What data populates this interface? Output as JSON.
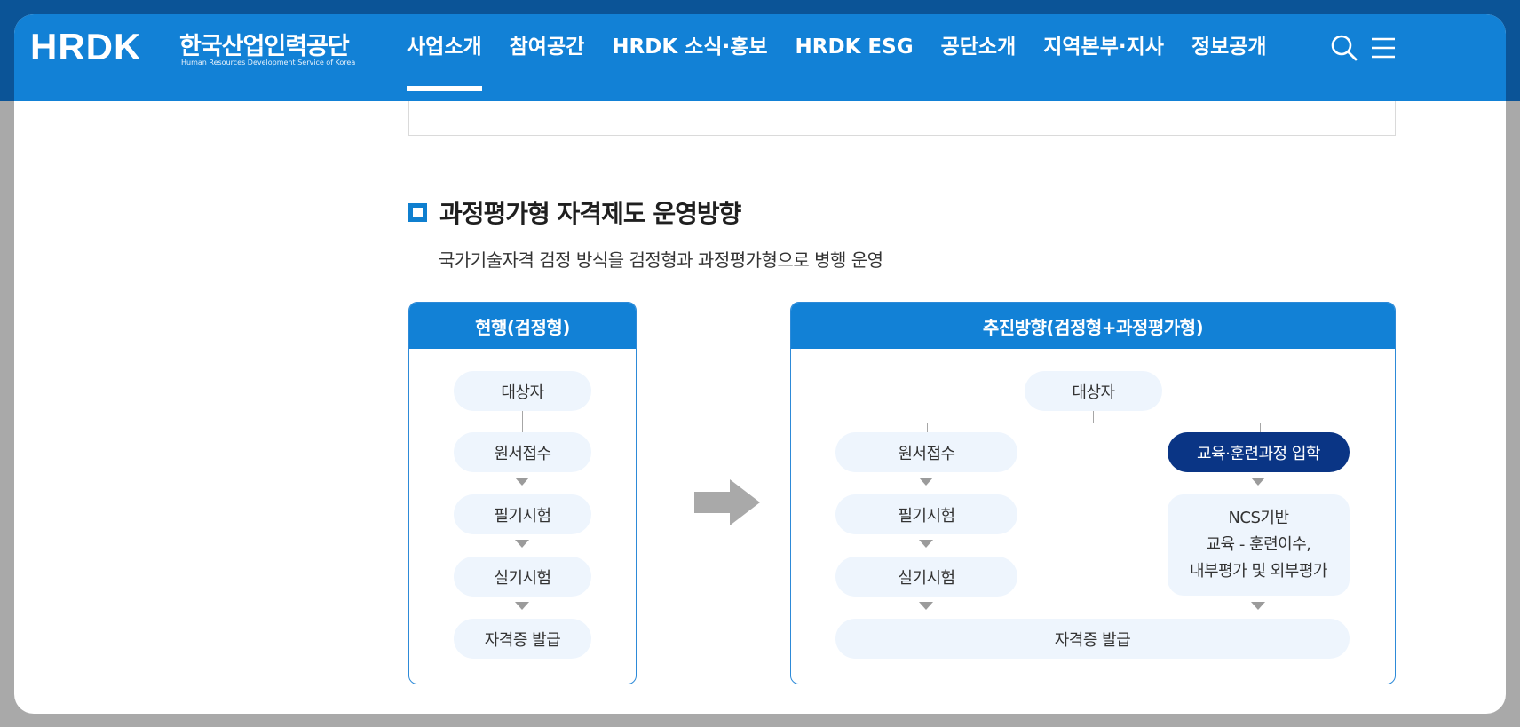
{
  "header": {
    "logo_text": "HRDK",
    "logo_ko": "한국산업인력공단",
    "logo_en": "Human Resources Development Service of Korea",
    "menu": [
      {
        "label": "사업소개",
        "active": true
      },
      {
        "label": "참여공간",
        "active": false
      },
      {
        "label": "HRDK 소식·홍보",
        "active": false
      },
      {
        "label": "HRDK ESG",
        "active": false
      },
      {
        "label": "공단소개",
        "active": false
      },
      {
        "label": "지역본부·지사",
        "active": false
      },
      {
        "label": "정보공개",
        "active": false
      }
    ],
    "search_icon": "search-icon",
    "menu_icon": "hamburger-menu-icon"
  },
  "section": {
    "title": "과정평가형 자격제도 운영방향",
    "desc": "국가기술자격 검정 방식을 검정형과 과정평가형으로 병행 운영"
  },
  "diagram": {
    "current": {
      "title": "현행(검정형)",
      "steps": [
        "대상자",
        "원서접수",
        "필기시험",
        "실기시험",
        "자격증 발급"
      ]
    },
    "future": {
      "title": "추진방향(검정형+과정평가형)",
      "top": "대상자",
      "left_steps": [
        "원서접수",
        "필기시험",
        "실기시험"
      ],
      "right_top": "교육·훈련과정 입학",
      "right_box": [
        "NCS기반",
        "교육 - 훈련이수,",
        "내부평가 및 외부평가"
      ],
      "bottom": "자격증 발급"
    }
  },
  "colors": {
    "nav_bg": "#1281d6",
    "top_band": "#0b5497",
    "accent_dark": "#0a3585",
    "pill_bg": "#eef5fd"
  }
}
